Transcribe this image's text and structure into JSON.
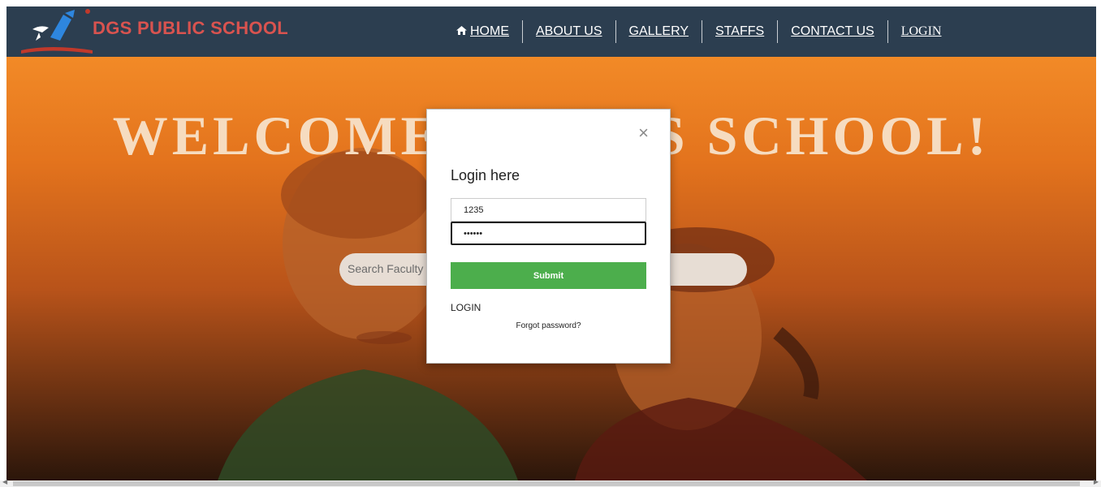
{
  "brand": {
    "name": "DGS PUBLIC SCHOOL",
    "color": "#d9534f"
  },
  "nav": {
    "home_icon": "home-icon",
    "items": [
      "HOME",
      "ABOUT US",
      "GALLERY",
      "STAFFS",
      "CONTACT US",
      "LOGIN"
    ]
  },
  "hero": {
    "title": "WELCOME TO DGS SCHOOL!",
    "search_placeholder": "Search Faculty"
  },
  "login_modal": {
    "title": "Login here",
    "close_label": "×",
    "username_value": "1235",
    "password_value": "••••••",
    "submit_label": "Submit",
    "login_link": "LOGIN",
    "forgot_link": "Forgot password?"
  },
  "colors": {
    "navbar_bg": "#2c3e50",
    "submit_bg": "#4cae4c",
    "hero_orange": "#f28a27"
  }
}
